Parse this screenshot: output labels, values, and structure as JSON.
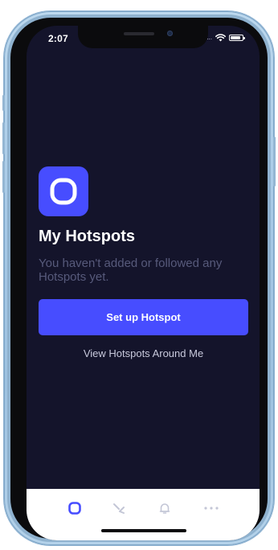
{
  "status_bar": {
    "time": "2:07",
    "signal": "....",
    "battery_level": 0.85
  },
  "main": {
    "title": "My Hotspots",
    "subtitle": "You haven't added or followed any Hotspots yet.",
    "primary_button_label": "Set up Hotspot",
    "secondary_link_label": "View Hotspots Around Me"
  },
  "tab_bar": {
    "items": [
      {
        "icon": "hotspot-icon",
        "active": true
      },
      {
        "icon": "activity-icon",
        "active": false
      },
      {
        "icon": "bell-icon",
        "active": false
      },
      {
        "icon": "more-icon",
        "active": false
      }
    ]
  },
  "colors": {
    "background": "#14142b",
    "accent": "#474dff",
    "subtitle": "#575a7b",
    "tab_inactive": "#c3c6d6"
  }
}
